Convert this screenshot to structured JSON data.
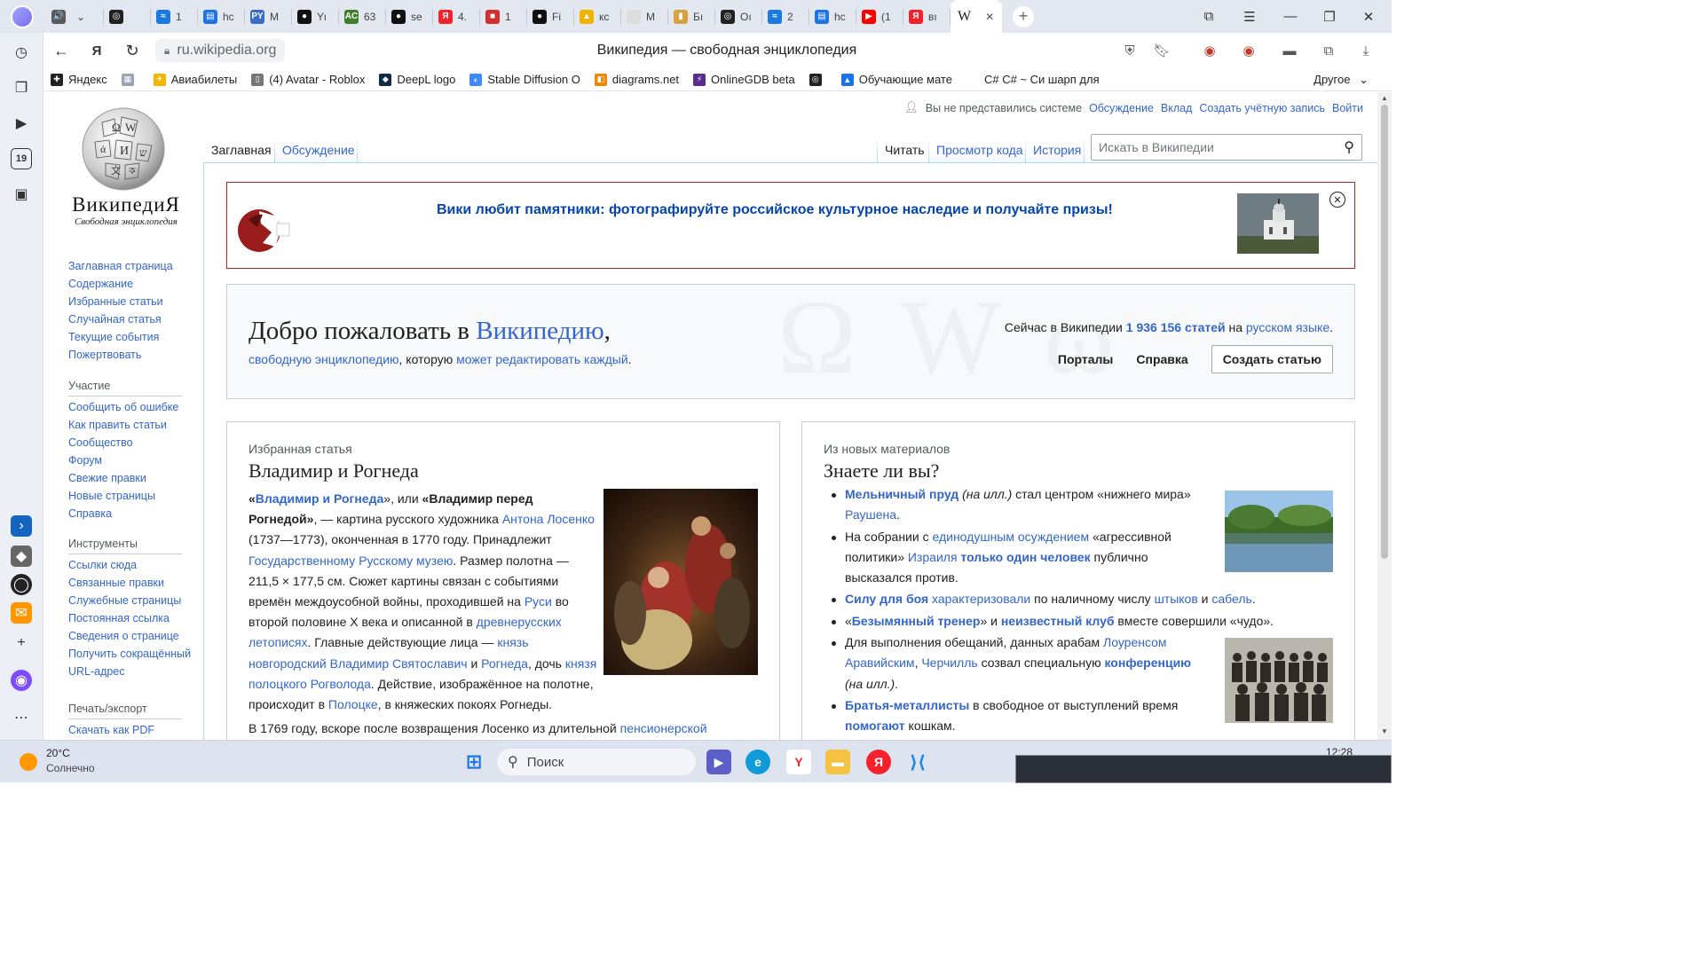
{
  "browser": {
    "tabs": [
      {
        "label": "",
        "fav_color": "#5a5a5a",
        "glyph": "🔊"
      },
      {
        "label": "",
        "fav_color": "#222222",
        "glyph": "◎"
      },
      {
        "label": "1",
        "fav_color": "#1a7ae0",
        "glyph": "≈"
      },
      {
        "label": "hc",
        "fav_color": "#1e73e8",
        "glyph": "▤"
      },
      {
        "label": "M",
        "fav_color": "#3b6dc6",
        "glyph": "PY"
      },
      {
        "label": "Yι",
        "fav_color": "#111111",
        "glyph": "●"
      },
      {
        "label": "63",
        "fav_color": "#3d7f2a",
        "glyph": "AC"
      },
      {
        "label": "se",
        "fav_color": "#111111",
        "glyph": "●"
      },
      {
        "label": "4.",
        "fav_color": "#f5222d",
        "glyph": "Я"
      },
      {
        "label": "1",
        "fav_color": "#d32f2f",
        "glyph": "■"
      },
      {
        "label": "Fi",
        "fav_color": "#111111",
        "glyph": "●"
      },
      {
        "label": "кс",
        "fav_color": "#f0b400",
        "glyph": "▲"
      },
      {
        "label": "M",
        "fav_color": "#dddddd",
        "glyph": ""
      },
      {
        "label": "Бı",
        "fav_color": "#d8a040",
        "glyph": "▮"
      },
      {
        "label": "Oı",
        "fav_color": "#222222",
        "glyph": "◎"
      },
      {
        "label": "2",
        "fav_color": "#1a7ae0",
        "glyph": "≈"
      },
      {
        "label": "hc",
        "fav_color": "#1e73e8",
        "glyph": "▤"
      },
      {
        "label": "(1",
        "fav_color": "#ff0000",
        "glyph": "▶"
      },
      {
        "label": "вı",
        "fav_color": "#f5222d",
        "glyph": "Я"
      }
    ],
    "active_tab_label": "W",
    "url": "ru.wikipedia.org",
    "page_title": "Википедия — свободная энциклопедия",
    "bookmarks": [
      {
        "label": "Яндекс",
        "color": "#222222",
        "glyph": "✚"
      },
      {
        "label": "",
        "color": "#9aa4b5",
        "glyph": "▦"
      },
      {
        "label": "Авиабилеты",
        "color": "#f4b400",
        "glyph": "✈"
      },
      {
        "label": "(4) Avatar - Roblox",
        "color": "#777777",
        "glyph": "▯"
      },
      {
        "label": "DeepL logo",
        "color": "#0f2b46",
        "glyph": "◆"
      },
      {
        "label": "Stable Diffusion O",
        "color": "#3d8bfd",
        "glyph": "◐"
      },
      {
        "label": "diagrams.net",
        "color": "#f08705",
        "glyph": "◧"
      },
      {
        "label": "OnlineGDB beta",
        "color": "#5b2d90",
        "glyph": "⚡"
      },
      {
        "label": "",
        "color": "#222222",
        "glyph": "◎"
      },
      {
        "label": "Обучающие мате",
        "color": "#1a73e8",
        "glyph": "▲"
      },
      {
        "label": "C# C# ~ Си шарп для",
        "color": "#ffffff",
        "glyph": ""
      }
    ],
    "bookmarks_other": "Другое"
  },
  "wiki": {
    "wordmark": "ВикипедиЯ",
    "tagline": "Свободная энциклопедия",
    "nav": [
      "Заглавная страница",
      "Содержание",
      "Избранные статьи",
      "Случайная статья",
      "Текущие события",
      "Пожертвовать"
    ],
    "participation": {
      "heading": "Участие",
      "items": [
        "Сообщить об ошибке",
        "Как править статьи",
        "Сообщество",
        "Форум",
        "Свежие правки",
        "Новые страницы",
        "Справка"
      ]
    },
    "tools": {
      "heading": "Инструменты",
      "items": [
        "Ссылки сюда",
        "Связанные правки",
        "Служебные страницы",
        "Постоянная ссылка",
        "Сведения о странице",
        "Получить сокращённый URL-адрес"
      ]
    },
    "print": {
      "heading": "Печать/экспорт",
      "items": [
        "Скачать как PDF"
      ]
    },
    "personal": {
      "not_logged": "Вы не представились системе",
      "discussion": "Обсуждение",
      "contrib": "Вклад",
      "create_account": "Создать учётную запись",
      "login": "Войти"
    },
    "tabs": {
      "main": "Заглавная",
      "talk": "Обсуждение",
      "read": "Читать",
      "view_source": "Просмотр кода",
      "history": "История"
    },
    "search_placeholder": "Искать в Википедии",
    "banner": "Вики любит памятники: фотографируйте российское культурное наследие и получайте призы!",
    "welcome": {
      "title_1": "Добро пожаловать в ",
      "title_link": "Википедию",
      "title_2": ",",
      "sub_link1": "свободную энциклопедию",
      "sub_text": ", которую ",
      "sub_link2": "может редактировать каждый",
      "sub_end": ".",
      "stats_1": "Сейчас в Википедии ",
      "stats_count": "1 936 156 статей",
      "stats_2": " на ",
      "stats_lang": "русском языке",
      "stats_end": ".",
      "portals": "Порталы",
      "help": "Справка",
      "create": "Создать статью"
    },
    "featured": {
      "category": "Избранная статья",
      "title": "Владимир и Рогнеда",
      "p1": [
        {
          "t": "«",
          "s": "b"
        },
        {
          "t": "Владимир и Рогнеда",
          "s": "bl"
        },
        {
          "t": "», или ",
          "s": ""
        },
        {
          "t": "«Владимир перед Рогнедой»",
          "s": "b"
        },
        {
          "t": ", — картина русского художника ",
          "s": ""
        },
        {
          "t": "Антона Лосенко",
          "s": "l"
        },
        {
          "t": " (1737—1773), оконченная в 1770 году. Принадлежит ",
          "s": ""
        },
        {
          "t": "Государственному Русскому музею",
          "s": "l"
        },
        {
          "t": ". Размер полотна — 211,5 × 177,5 см. Сюжет картины связан с событиями времён междоусобной войны, проходившей на ",
          "s": ""
        },
        {
          "t": "Руси",
          "s": "l"
        },
        {
          "t": " во второй половине X века и описанной в ",
          "s": ""
        },
        {
          "t": "древнерусских летописях",
          "s": "l"
        },
        {
          "t": ". Главные действующие лица — ",
          "s": ""
        },
        {
          "t": "князь новгородский Владимир Святославич",
          "s": "l"
        },
        {
          "t": " и ",
          "s": ""
        },
        {
          "t": "Рогнеда",
          "s": "l"
        },
        {
          "t": ", дочь ",
          "s": ""
        },
        {
          "t": "князя полоцкого Рогволода",
          "s": "l"
        },
        {
          "t": ". Действие, изображённое на полотне, происходит в ",
          "s": ""
        },
        {
          "t": "Полоцке",
          "s": "l"
        },
        {
          "t": ", в княжеских покоях Рогнеды.",
          "s": ""
        }
      ],
      "p2": [
        {
          "t": "В 1769 году, вскоре после возвращения Лосенко из длительной ",
          "s": ""
        },
        {
          "t": "пенсионерской",
          "s": "l"
        }
      ]
    },
    "dyk": {
      "category": "Из новых материалов",
      "title": "Знаете ли вы?",
      "items": [
        [
          {
            "t": "Мельничный пруд",
            "s": "bl"
          },
          {
            "t": " (на илл.)",
            "s": "i"
          },
          {
            "t": " стал центром «нижнего мира» ",
            "s": ""
          },
          {
            "t": "Раушена",
            "s": "l"
          },
          {
            "t": ".",
            "s": ""
          }
        ],
        [
          {
            "t": "На собрании с ",
            "s": ""
          },
          {
            "t": "единодушным осуждением",
            "s": "l"
          },
          {
            "t": " «агрессивной политики» ",
            "s": ""
          },
          {
            "t": "Израиля",
            "s": "l"
          },
          {
            "t": " ",
            "s": ""
          },
          {
            "t": "только один человек",
            "s": "bl"
          },
          {
            "t": " публично высказался против.",
            "s": ""
          }
        ],
        [
          {
            "t": "Силу для боя",
            "s": "bl"
          },
          {
            "t": " ",
            "s": ""
          },
          {
            "t": "характеризовали",
            "s": "l"
          },
          {
            "t": " по наличному числу ",
            "s": ""
          },
          {
            "t": "штыков",
            "s": "l"
          },
          {
            "t": " и ",
            "s": ""
          },
          {
            "t": "сабель",
            "s": "l"
          },
          {
            "t": ".",
            "s": ""
          }
        ],
        [
          {
            "t": "«",
            "s": ""
          },
          {
            "t": "Безымянный тренер",
            "s": "bl"
          },
          {
            "t": "» и ",
            "s": ""
          },
          {
            "t": "неизвестный клуб",
            "s": "bl"
          },
          {
            "t": " вместе совершили «чудо».",
            "s": ""
          }
        ],
        [
          {
            "t": "Для выполнения обещаний, данных арабам ",
            "s": ""
          },
          {
            "t": "Лоуренсом Аравийским",
            "s": "l"
          },
          {
            "t": ", ",
            "s": ""
          },
          {
            "t": "Черчилль",
            "s": "l"
          },
          {
            "t": " созвал специальную ",
            "s": ""
          },
          {
            "t": "конференцию",
            "s": "bl"
          },
          {
            "t": " (на илл.)",
            "s": "i"
          },
          {
            "t": ".",
            "s": ""
          }
        ],
        [
          {
            "t": "Братья-металлисты",
            "s": "bl"
          },
          {
            "t": " в свободное от выступлений время ",
            "s": ""
          },
          {
            "t": "помогают",
            "s": "bl"
          },
          {
            "t": " кошкам.",
            "s": ""
          }
        ]
      ]
    }
  },
  "taskbar": {
    "weather_temp": "20°C",
    "weather_desc": "Солнечно",
    "search": "Поиск",
    "time": "12:28"
  },
  "colors": {
    "link": "#3366cc",
    "banner_border": "#b32424",
    "tabstrip": "#e3e7ef",
    "taskbar": "#dde4ef"
  }
}
